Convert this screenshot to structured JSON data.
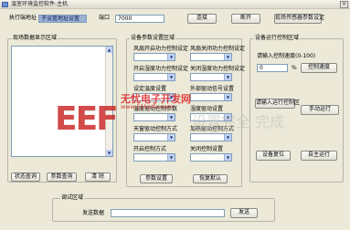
{
  "window": {
    "title": "温室环境监控软件-主机",
    "close_glyph": "×"
  },
  "top_bar": {
    "server_label": "执行端地址",
    "server_value": "子设置地址设置",
    "port_label": "端口",
    "port_value": "7000",
    "connect_label": "连接",
    "disconnect_label": "断开",
    "query_label": "现场传感器参数设定"
  },
  "left_panel": {
    "title": "现场数据显示区域",
    "status_button": "状态查询",
    "param_button": "参数查询",
    "clear_button": "清 除"
  },
  "middle_panel": {
    "title": "设备参数设置区域",
    "fields": [
      {
        "label": "风扇开启功力控制设定"
      },
      {
        "label": "风扇关闭功力控制设定"
      },
      {
        "label": "开启湿度功力控制设定"
      },
      {
        "label": "关闭湿度功力控制设定"
      },
      {
        "label": "设定温度设置"
      },
      {
        "label": "外部驱动信号设置"
      },
      {
        "label": "温度驱动控制参数"
      },
      {
        "label": "湿度驱动设置"
      },
      {
        "label": "天窗驱动控制方式"
      },
      {
        "label": "加热驱动控制方式"
      },
      {
        "label": "开启控制方式"
      },
      {
        "label": "关闭控制设置"
      }
    ],
    "set_button": "参数设置",
    "default_button": "恢复默认"
  },
  "right_panel": {
    "title": "设备运行控制区域",
    "prompt": "请输入控制速度(0-100)",
    "value": "0",
    "unit": "%",
    "speed_button": "控制速度",
    "run_button": "请输入运行控制区",
    "manual_button": "手动运行",
    "device_button": "设备复位",
    "auto_button": "自主运行"
  },
  "bottom_panel": {
    "title": "调试区域",
    "send_label": "发送数据",
    "send_button": "发送"
  },
  "watermark": {
    "logo": "EEF",
    "cn": "无忧电子开发网",
    "url": "www.51kaifa.com",
    "big": "设置完全 完成"
  }
}
